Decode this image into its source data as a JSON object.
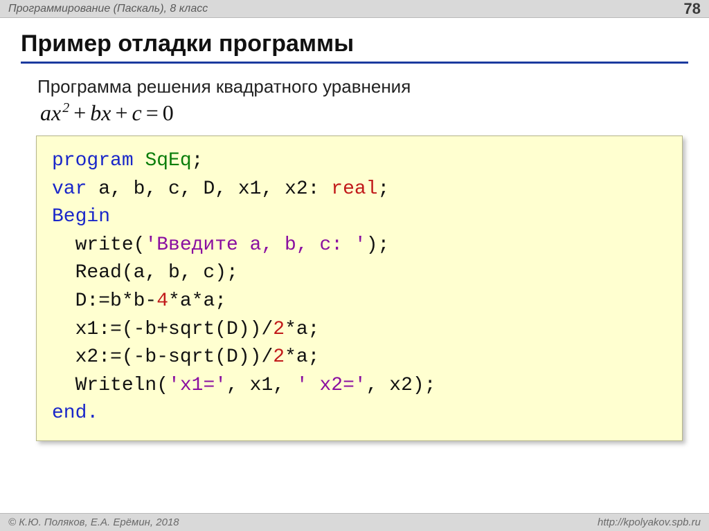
{
  "header": {
    "title": "Программирование (Паскаль), 8 класс",
    "page_number": "78"
  },
  "slide": {
    "title": "Пример отладки программы",
    "subtitle": "Программа решения квадратного уравнения",
    "equation": {
      "a": "a",
      "x": "x",
      "sup2": "2",
      "plus1": "+",
      "b": "b",
      "plus2": "+",
      "c": "c",
      "eq": "=",
      "zero": "0"
    }
  },
  "code": {
    "kw_program": "program",
    "prog_name": "SqEq",
    "semi": ";",
    "kw_var": "var",
    "var_decl": " a, b, c, D, x1, x2: ",
    "kw_real": "real",
    "kw_begin": "Begin",
    "l1a": "  write(",
    "str1": "'Введите a, b, c: '",
    "l1b": ");",
    "l2": "  Read(a, b, c);",
    "l3a": "  D:=b*b-",
    "num4": "4",
    "l3b": "*a*a;",
    "l4a": "  x1:=(-b+sqrt(D))/",
    "num2a": "2",
    "l4b": "*a;",
    "l5a": "  x2:=(-b-sqrt(D))/",
    "num2b": "2",
    "l5b": "*a;",
    "l6a": "  Writeln(",
    "str2": "'x1='",
    "l6b": ", x1, ",
    "str3": "' x2='",
    "l6c": ", x2);",
    "kw_end": "end."
  },
  "footer": {
    "authors": "© К.Ю. Поляков, Е.А. Ерёмин, 2018",
    "url": "http://kpolyakov.spb.ru"
  }
}
